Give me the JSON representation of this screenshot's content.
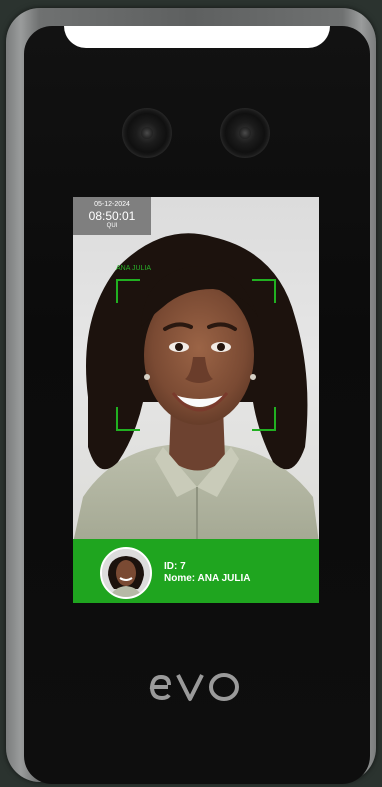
{
  "screen": {
    "date": "05-12-2024",
    "time": "08:50:01",
    "weekday": "QUI",
    "face_label": "ANA JULIA"
  },
  "result": {
    "id_text": "ID: 7",
    "name_text": "Nome: ANA JULIA"
  },
  "brand": {
    "logo_text": "evo"
  },
  "colors": {
    "recognition_green": "#1fa51f",
    "frame_green": "#21b021",
    "device_body": "#0e0e0e"
  }
}
